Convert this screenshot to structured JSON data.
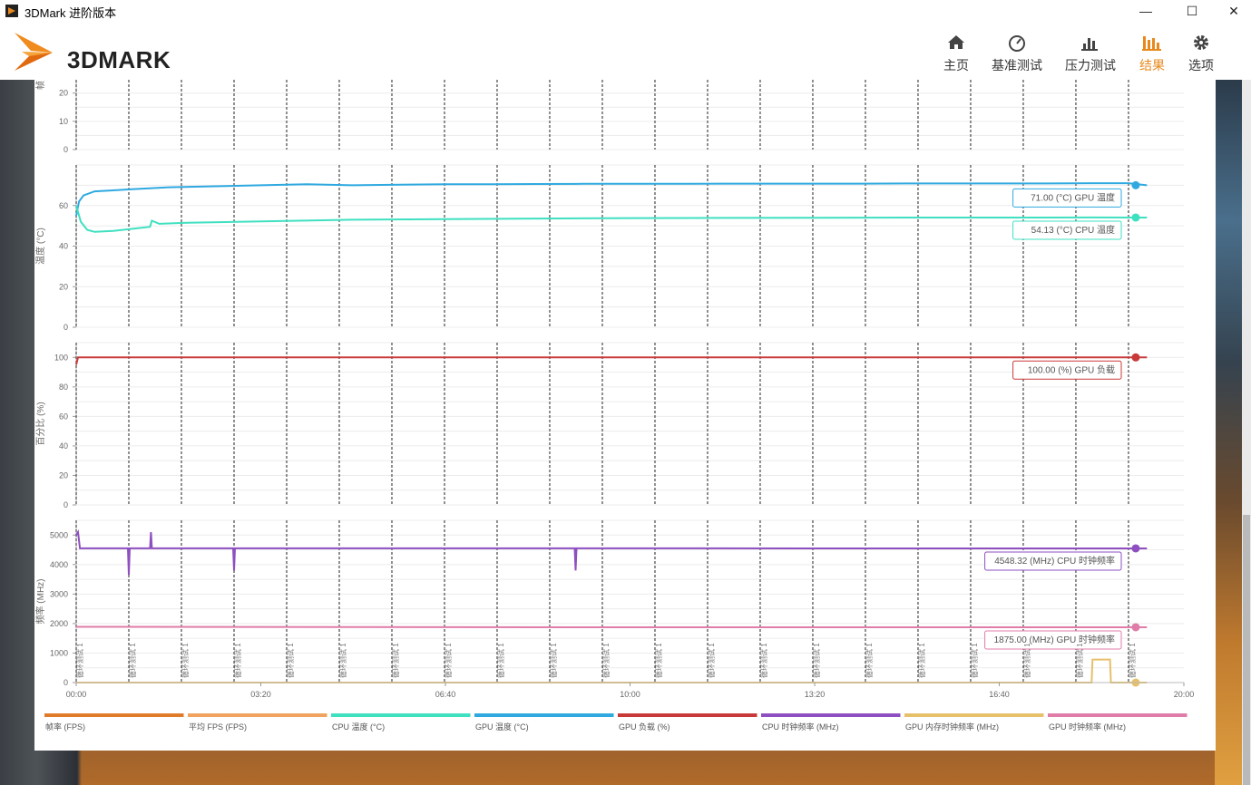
{
  "window": {
    "title": "3DMark 进阶版本",
    "min": "—",
    "max": "☐",
    "close": "✕"
  },
  "brand": {
    "name": "3DMARK"
  },
  "nav": [
    {
      "label": "主页",
      "icon": "home-icon",
      "active": false
    },
    {
      "label": "基准测试",
      "icon": "gauge-icon",
      "active": false
    },
    {
      "label": "压力测试",
      "icon": "bar-chart-icon",
      "active": false
    },
    {
      "label": "结果",
      "icon": "results-chart-icon",
      "active": true
    },
    {
      "label": "选项",
      "icon": "gear-icon",
      "active": false
    }
  ],
  "colors": {
    "accent": "#e8891e",
    "fps": "#e07b2a",
    "avg_fps": "#f0a35e",
    "cpu_temp": "#3fe0c0",
    "gpu_temp": "#2fa9e0",
    "gpu_load": "#c83a3a",
    "cpu_clock": "#8e4fc0",
    "gpu_mem_clock": "#e6c06a",
    "gpu_clock": "#e07ca8"
  },
  "chart_data": {
    "type": "line",
    "x_ticks": [
      "00:00",
      "03:20",
      "06:40",
      "10:00",
      "13:20",
      "16:40",
      "20:00"
    ],
    "xlim_seconds": [
      0,
      1200
    ],
    "loop_marker_label": "循环测试 1",
    "loop_markers_seconds": [
      0,
      57,
      114,
      171,
      228,
      285,
      342,
      399,
      456,
      513,
      570,
      627,
      684,
      741,
      798,
      855,
      912,
      969,
      1026,
      1083,
      1140
    ],
    "panels": [
      {
        "ylabel": "帧",
        "yticks": [
          0,
          10,
          20
        ],
        "series": []
      },
      {
        "ylabel": "温度 (°C)",
        "yticks": [
          0,
          20,
          40,
          60
        ],
        "ylim": [
          0,
          80
        ],
        "series": [
          {
            "name": "GPU 温度",
            "unit": "°C",
            "final_label": "71.00 (°C) GPU 温度",
            "points": [
              [
                0,
                55
              ],
              [
                3,
                62
              ],
              [
                8,
                65
              ],
              [
                20,
                67
              ],
              [
                40,
                67.5
              ],
              [
                60,
                68
              ],
              [
                100,
                69
              ],
              [
                150,
                69.5
              ],
              [
                200,
                70
              ],
              [
                250,
                70.5
              ],
              [
                300,
                70
              ],
              [
                350,
                70.3
              ],
              [
                400,
                70.5
              ],
              [
                450,
                70.5
              ],
              [
                500,
                70.6
              ],
              [
                550,
                70.7
              ],
              [
                600,
                70.7
              ],
              [
                650,
                70.7
              ],
              [
                700,
                70.8
              ],
              [
                750,
                70.8
              ],
              [
                800,
                70.8
              ],
              [
                850,
                70.8
              ],
              [
                900,
                70.9
              ],
              [
                950,
                70.9
              ],
              [
                1000,
                70.9
              ],
              [
                1050,
                70.9
              ],
              [
                1100,
                71
              ],
              [
                1140,
                71
              ],
              [
                1160,
                70
              ]
            ]
          },
          {
            "name": "CPU 温度",
            "unit": "°C",
            "final_label": "54.13 (°C) CPU 温度",
            "points": [
              [
                0,
                60
              ],
              [
                5,
                52
              ],
              [
                12,
                48
              ],
              [
                20,
                47
              ],
              [
                40,
                47.5
              ],
              [
                60,
                48.5
              ],
              [
                80,
                49.5
              ],
              [
                82,
                52.5
              ],
              [
                90,
                51
              ],
              [
                120,
                51.5
              ],
              [
                180,
                52
              ],
              [
                240,
                52.5
              ],
              [
                300,
                53
              ],
              [
                400,
                53.3
              ],
              [
                500,
                53.6
              ],
              [
                600,
                53.8
              ],
              [
                700,
                53.9
              ],
              [
                800,
                54
              ],
              [
                900,
                54.1
              ],
              [
                1000,
                54.1
              ],
              [
                1100,
                54.13
              ],
              [
                1160,
                54.1
              ]
            ]
          }
        ]
      },
      {
        "ylabel": "百分比 (%)",
        "yticks": [
          0,
          20,
          40,
          60,
          80,
          100
        ],
        "ylim": [
          0,
          110
        ],
        "series": [
          {
            "name": "GPU 负载",
            "unit": "%",
            "final_label": "100.00 (%) GPU 负载",
            "points": [
              [
                0,
                95
              ],
              [
                2,
                100
              ],
              [
                1160,
                100
              ]
            ]
          }
        ]
      },
      {
        "ylabel": "频率 (MHz)",
        "yticks": [
          0,
          1000,
          2000,
          3000,
          4000,
          5000
        ],
        "ylim": [
          0,
          5500
        ],
        "series": [
          {
            "name": "CPU 时钟频率",
            "unit": "MHz",
            "final_label": "4548.32 (MHz) CPU 时钟频率",
            "points": [
              [
                0,
                5000
              ],
              [
                2,
                5100
              ],
              [
                4,
                4550
              ],
              [
                56,
                4550
              ],
              [
                57,
                3650
              ],
              [
                58,
                4550
              ],
              [
                80,
                4550
              ],
              [
                81,
                5100
              ],
              [
                82,
                4550
              ],
              [
                170,
                4550
              ],
              [
                171,
                3800
              ],
              [
                172,
                4550
              ],
              [
                540,
                4550
              ],
              [
                541,
                3800
              ],
              [
                542,
                4550
              ],
              [
                1160,
                4548
              ]
            ]
          },
          {
            "name": "GPU 时钟频率",
            "unit": "MHz",
            "final_label": "1875.00 (MHz) GPU 时钟频率",
            "points": [
              [
                0,
                1890
              ],
              [
                300,
                1880
              ],
              [
                600,
                1875
              ],
              [
                900,
                1875
              ],
              [
                1160,
                1875
              ]
            ]
          },
          {
            "name": "GPU 内存时钟频率",
            "unit": "MHz",
            "final_label": "",
            "points": [
              [
                0,
                0
              ],
              [
                1100,
                0
              ],
              [
                1101,
                780
              ],
              [
                1120,
                780
              ],
              [
                1121,
                0
              ],
              [
                1160,
                0
              ]
            ]
          }
        ]
      }
    ],
    "legend": [
      {
        "label": "帧率 (FPS)",
        "color": "#e07b2a"
      },
      {
        "label": "平均 FPS (FPS)",
        "color": "#f0a35e"
      },
      {
        "label": "CPU 温度 (°C)",
        "color": "#3fe0c0"
      },
      {
        "label": "GPU 温度 (°C)",
        "color": "#2fa9e0"
      },
      {
        "label": "GPU 负载 (%)",
        "color": "#c83a3a"
      },
      {
        "label": "CPU 时钟频率 (MHz)",
        "color": "#8e4fc0"
      },
      {
        "label": "GPU 内存时钟频率 (MHz)",
        "color": "#e6c06a"
      },
      {
        "label": "GPU 时钟频率 (MHz)",
        "color": "#e07ca8"
      }
    ]
  }
}
